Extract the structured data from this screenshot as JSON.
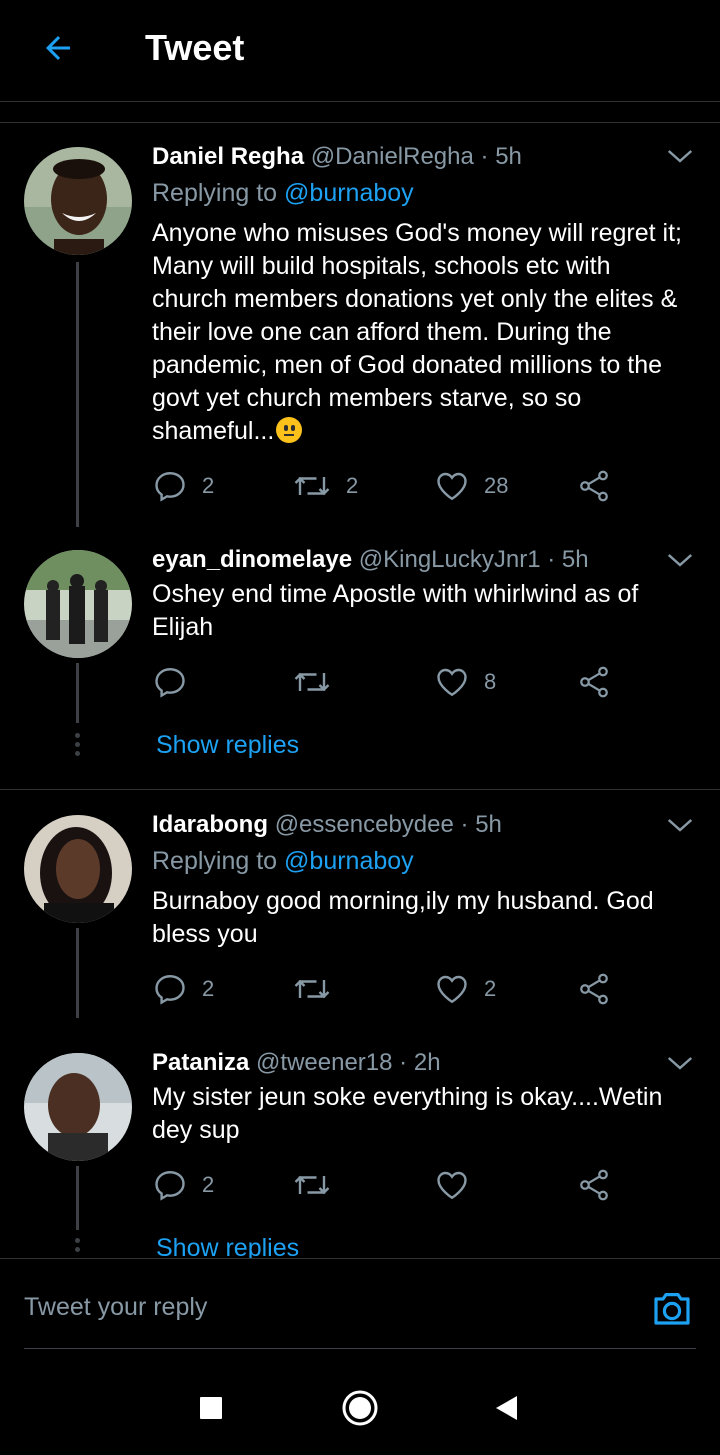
{
  "header": {
    "title": "Tweet"
  },
  "tweets": [
    {
      "name": "Daniel Regha",
      "handle": "@DanielRegha",
      "time": "5h",
      "replying_label": "Replying to",
      "replying_to": "@burnaboy",
      "text": "Anyone who misuses God's money will regret it; Many will build hospitals, schools etc with church members donations yet only the elites & their love one can afford them. During the pandemic, men of God donated millions to the govt yet church members starve, so so shameful...",
      "emoji": "neutral-face",
      "replies": "2",
      "retweets": "2",
      "likes": "28"
    },
    {
      "name": "eyan_dinomelaye",
      "handle": "@KingLuckyJnr1",
      "time": "5h",
      "text": "Oshey end time Apostle with whirlwind as of Elijah",
      "replies": "",
      "retweets": "",
      "likes": "8",
      "show_replies": "Show replies"
    },
    {
      "name": "Idarabong",
      "handle": "@essencebydee",
      "time": "5h",
      "replying_label": "Replying to",
      "replying_to": "@burnaboy",
      "text": "Burnaboy good morning,ily my husband. God bless you",
      "replies": "2",
      "retweets": "",
      "likes": "2"
    },
    {
      "name": "Pataniza",
      "handle": "@tweener18",
      "time": "2h",
      "text": "My sister jeun soke everything is okay....Wetin dey sup",
      "replies": "2",
      "retweets": "",
      "likes": "",
      "show_replies": "Show replies"
    }
  ],
  "separator": "·",
  "composer": {
    "placeholder": "Tweet your reply"
  },
  "colors": {
    "accent": "#1da1f2",
    "muted": "#8899a6",
    "background": "#000000",
    "border": "#2f3336"
  }
}
